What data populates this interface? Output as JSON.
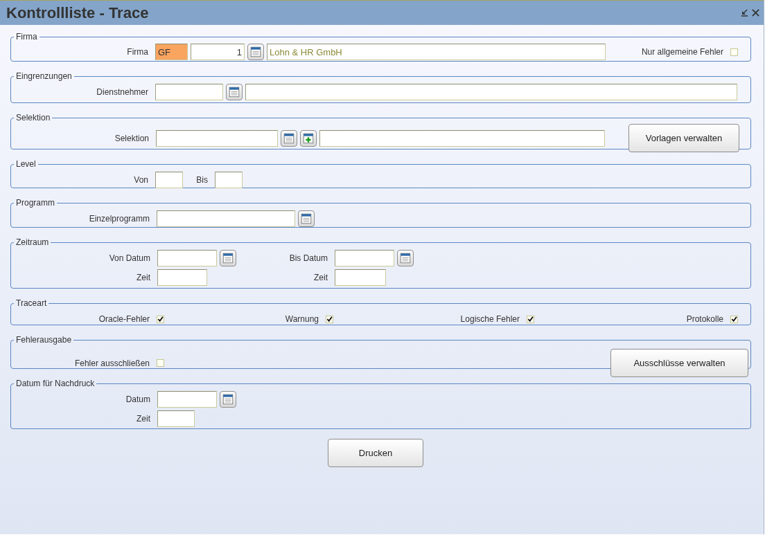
{
  "window": {
    "title": "Kontrollliste - Trace"
  },
  "sections": [
    {
      "legend": "Firma",
      "rows": [
        {
          "items": [
            {
              "kind": "label",
              "text": "Firma"
            },
            {
              "kind": "input",
              "value": "GF",
              "highlighted": true
            },
            {
              "kind": "number",
              "value": "1",
              "highlighted": false
            },
            {
              "kind": "lookup"
            },
            {
              "kind": "display",
              "value": "Lohn & HR GmbH",
              "highlighted": false
            },
            {
              "kind": "label",
              "text": "Nur allgemeine Fehler"
            },
            {
              "kind": "checkbox",
              "checked": false
            }
          ]
        }
      ]
    },
    {
      "legend": "Eingrenzungen",
      "rows": [
        {
          "items": [
            {
              "kind": "label",
              "text": "Dienstnehmer"
            },
            {
              "kind": "input",
              "highlighted": false
            },
            {
              "kind": "lookup"
            },
            {
              "kind": "input",
              "highlighted": false
            }
          ]
        }
      ]
    },
    {
      "legend": "Selektion",
      "rows": [
        {
          "items": [
            {
              "kind": "label",
              "text": "Selektion"
            },
            {
              "kind": "input",
              "highlighted": false
            },
            {
              "kind": "lookup"
            },
            {
              "kind": "add"
            },
            {
              "kind": "input",
              "highlighted": false
            },
            {
              "kind": "button",
              "text": "Vorlagen verwalten"
            }
          ]
        }
      ]
    },
    {
      "legend": "Level",
      "rows": [
        {
          "items": [
            {
              "kind": "label",
              "text": "Von"
            },
            {
              "kind": "input",
              "highlighted": false
            },
            {
              "kind": "label",
              "text": "Bis"
            },
            {
              "kind": "input",
              "highlighted": false
            }
          ]
        }
      ]
    },
    {
      "legend": "Programm",
      "rows": [
        {
          "items": [
            {
              "kind": "label",
              "text": "Einzelprogramm"
            },
            {
              "kind": "input",
              "highlighted": false
            },
            {
              "kind": "lookup"
            }
          ]
        }
      ]
    },
    {
      "legend": "Zeitraum",
      "rows": [
        {
          "items": [
            {
              "kind": "label",
              "text": "Von Datum"
            },
            {
              "kind": "input",
              "highlighted": false
            },
            {
              "kind": "lookup"
            },
            {
              "kind": "label",
              "text": "Bis Datum"
            },
            {
              "kind": "input",
              "highlighted": false
            },
            {
              "kind": "lookup"
            }
          ]
        },
        {
          "items": [
            {
              "kind": "label",
              "text": "Zeit"
            },
            {
              "kind": "input",
              "highlighted": false
            },
            {
              "kind": "label",
              "text": "Zeit"
            },
            {
              "kind": "input",
              "highlighted": false
            }
          ]
        }
      ]
    },
    {
      "legend": "Traceart",
      "rows": [
        {
          "items": [
            {
              "kind": "label",
              "text": "Oracle-Fehler"
            },
            {
              "kind": "checkbox",
              "checked": true
            },
            {
              "kind": "label",
              "text": "Warnung"
            },
            {
              "kind": "checkbox",
              "checked": true
            },
            {
              "kind": "label",
              "text": "Logische Fehler"
            },
            {
              "kind": "checkbox",
              "checked": true
            },
            {
              "kind": "label",
              "text": "Protokolle"
            },
            {
              "kind": "checkbox",
              "checked": true
            }
          ]
        }
      ]
    },
    {
      "legend": "Fehlerausgabe",
      "rows": [
        {
          "items": [
            {
              "kind": "label",
              "text": "Fehler ausschließen"
            },
            {
              "kind": "checkbox",
              "checked": false
            },
            {
              "kind": "button",
              "text": "Ausschlüsse verwalten"
            }
          ]
        }
      ]
    },
    {
      "legend": "Datum für Nachdruck",
      "rows": [
        {
          "items": [
            {
              "kind": "label",
              "text": "Datum"
            },
            {
              "kind": "input",
              "highlighted": false
            },
            {
              "kind": "lookup"
            }
          ]
        },
        {
          "items": [
            {
              "kind": "label",
              "text": "Zeit"
            },
            {
              "kind": "input",
              "highlighted": false
            }
          ]
        }
      ]
    }
  ],
  "footer_button": "Drucken"
}
